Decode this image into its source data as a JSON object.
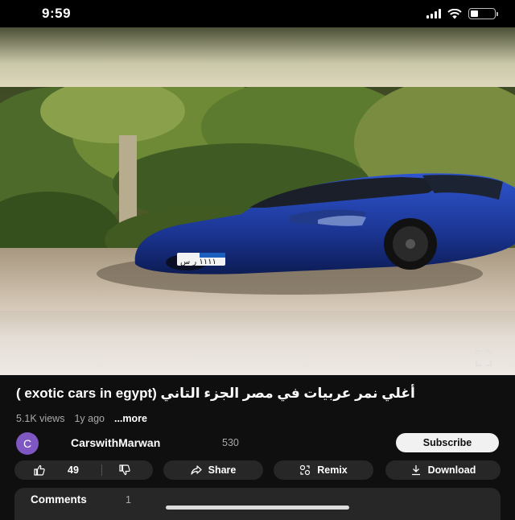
{
  "status": {
    "time": "9:59"
  },
  "video": {
    "title": "أغلي نمر عربيات في مصر الجزء التاني (exotic cars in egypt )",
    "views": "5.1K views",
    "age": "1y ago",
    "more": "...more",
    "plate_text": "١١١١ ر س"
  },
  "channel": {
    "avatar_letter": "C",
    "name": "CarswithMarwan",
    "subscribers": "530",
    "subscribe_label": "Subscribe"
  },
  "actions": {
    "likes": "49",
    "share": "Share",
    "remix": "Remix",
    "download": "Download"
  },
  "comments": {
    "label": "Comments",
    "count": "1"
  },
  "colors": {
    "background": "#0f0f0f",
    "pill": "#272727",
    "avatar": "#7e57c2",
    "car": "#1c3aa0"
  }
}
